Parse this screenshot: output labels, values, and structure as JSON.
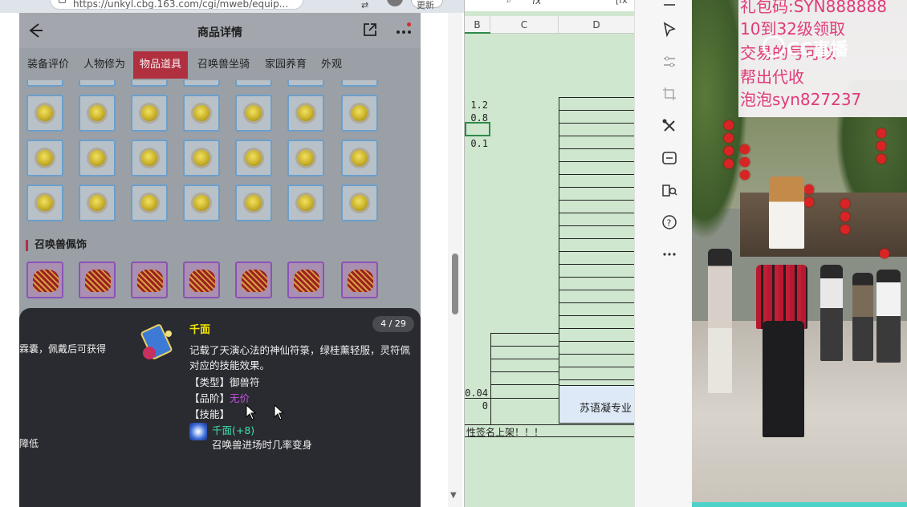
{
  "browser": {
    "url": "https://unkyl.cbg.163.com/cgi/mweb/equip...",
    "update_label": "更新",
    "top_icon_label": "⇄"
  },
  "phone": {
    "title": "商品详情",
    "tabs": [
      "装备评价",
      "人物修为",
      "物品道具",
      "召唤兽坐骑",
      "家园养育",
      "外观"
    ],
    "active_tab": "物品道具",
    "section_title": "召唤兽佩饰"
  },
  "tooltip": {
    "left_text_1": "霖囊，佩戴后可获得",
    "left_text_2": "障低",
    "item_name": "千面",
    "counter": "4 / 29",
    "desc_line_1": "记载了天演心法的神仙符箓，绿桂薰轻服，灵符佩",
    "desc_line_2": "对应的技能效果。",
    "type_line": "【类型】御兽符",
    "grade_label": "【品阶】",
    "grade_value": "无价",
    "skill_label": "【技能】",
    "skill_name": "千面(+8)",
    "skill_desc": "召唤兽进场时几率变身"
  },
  "sheet": {
    "fx": "fx",
    "search_icon": "search-icon",
    "columns": [
      "B",
      "C",
      "D"
    ],
    "values": [
      "1.2",
      "0.8",
      "0.1",
      "0.04",
      "0"
    ],
    "blue_cell_text": "苏语凝专业",
    "row_note": "性签名上架！！！"
  },
  "stream": {
    "overlay_lines": [
      "礼包码:SYN888888",
      "10到32级领取",
      "交易的号可以",
      "帮出代收",
      "泡泡syn827237"
    ],
    "logo_text": "CC直播"
  },
  "colors": {
    "active_tab": "#b03040",
    "item_name": "#f5e600",
    "grade": "#c050e0",
    "skill_name": "#40e0b0",
    "overlay_text": "#e03a78",
    "sheet_bg": "#cfe7cf"
  }
}
